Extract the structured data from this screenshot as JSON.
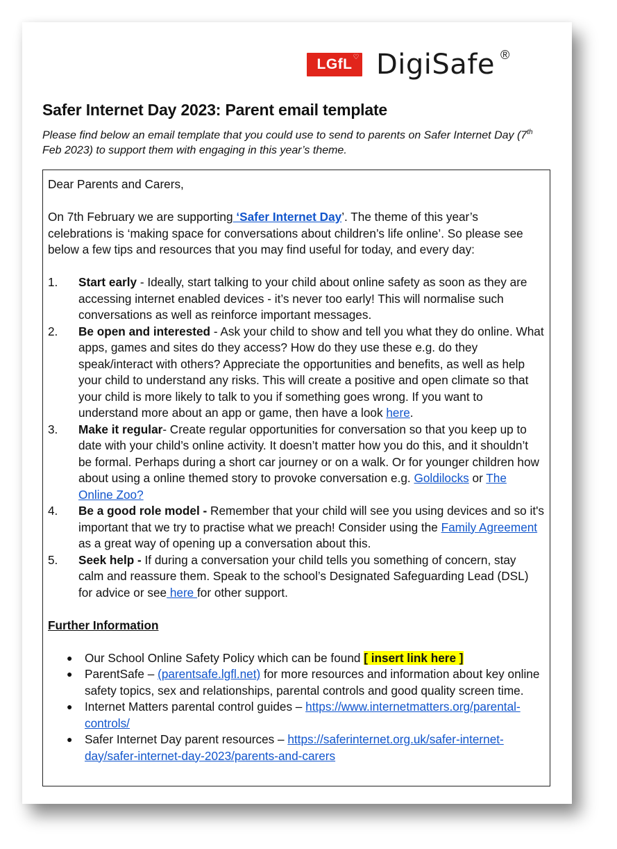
{
  "logo": {
    "badge_text": "LGfL",
    "badge_icon": "heart-icon",
    "brand_name": "DigiSafe",
    "registered_mark": "®",
    "badge_color": "#e1251b"
  },
  "title": "Safer Internet Day 2023: Parent email template",
  "intro": {
    "before_sup": "Please find below an email template that you could use to send to parents on Safer Internet Day (7",
    "sup": "th",
    "after_sup": " Feb 2023) to support them with engaging in this year’s theme."
  },
  "email": {
    "greeting": "Dear Parents and Carers,",
    "opening": {
      "before_link": "On 7th February we are supporting",
      "link": " ‘Safer Internet Day",
      "after_link": "’. The theme of this year’s celebrations is ‘making space for conversations about children’s life online’. So please see below a few tips and resources that you may find useful for today, and every day:"
    },
    "tips": [
      {
        "number": "1.",
        "heading": "Start early",
        "text": " - Ideally, start talking to your child about online safety as soon as they are accessing internet enabled devices - it’s never too early! This will normalise such conversations as well as reinforce important messages."
      },
      {
        "number": "2.",
        "heading": "Be open and interested",
        "text": " - Ask your child to show and tell you what they do online. What apps, games and sites do they access? How do they use these e.g. do they speak/interact with others? Appreciate the opportunities and benefits, as well as help your child to understand any risks. This will create a positive and open climate so that your child is more likely to talk to you if something goes wrong. If you want to understand more about an app or game, then have a look ",
        "link": "here",
        "after_link": "."
      },
      {
        "number": "3.",
        "heading": "Make it regular",
        "text": "- Create regular opportunities for conversation so that you keep up to date with your child’s online activity. It doesn’t matter how you do this, and it shouldn’t be formal. Perhaps during a short car journey or on a walk. Or for younger children how about using a online themed story to provoke conversation e.g. ",
        "link": "Goldilocks",
        "middle": " or ",
        "link2": "The Online Zoo?"
      },
      {
        "number": "4.",
        "heading": "Be a good role model",
        "heading_suffix": " -",
        "text": " Remember that your child will see you using devices and so it's important that we try to practise what we preach! Consider using the ",
        "link": "Family Agreement",
        "after_link": " as a great way of opening up a conversation about this."
      },
      {
        "number": "5.",
        "heading": "Seek help",
        "heading_suffix": " -",
        "text": " If during a conversation your child tells you something of concern, stay calm and reassure them. Speak to the school’s Designated Safeguarding Lead (DSL) for advice or see",
        "link": " here ",
        "after_link": "for other support."
      }
    ],
    "further_info": {
      "heading": "Further Information",
      "items": [
        {
          "text": "Our School Online Safety Policy which can be found ",
          "highlight": "[ insert link here ]"
        },
        {
          "text": "ParentSafe – ",
          "link": "(parentsafe.lgfl.net)",
          "after_link": " for more resources and information about key online safety topics, sex and relationships, parental controls and good quality screen time."
        },
        {
          "text": "Internet Matters parental control guides – ",
          "link": "https://www.internetmatters.org/parental-controls/"
        },
        {
          "text": "Safer Internet Day parent resources – ",
          "link": "https://saferinternet.org.uk/safer-internet-day/safer-internet-day-2023/parents-and-carers"
        }
      ]
    }
  },
  "colors": {
    "link": "#1155cc",
    "highlight": "#ffff00"
  }
}
